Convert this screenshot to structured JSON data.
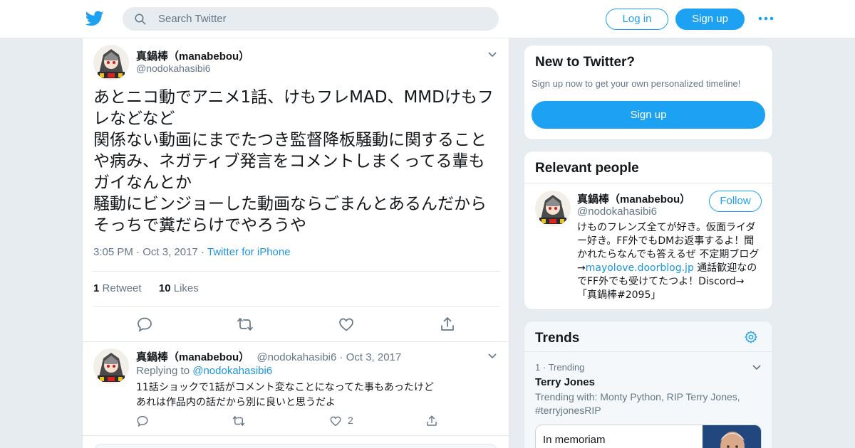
{
  "search": {
    "placeholder": "Search Twitter"
  },
  "header": {
    "login_label": "Log in",
    "signup_label": "Sign up"
  },
  "tweet": {
    "author_name": "真鍋棒（manabebou）",
    "author_handle": "@nodokahasibi6",
    "text": "あとニコ動でアニメ1話、けもフレMAD、MMDけもフレなどなど\n関係ない動画にまでたつき監督降板騒動に関することや病み、ネガティブ発言をコメントしまくってる輩もガイなんとか\n騒動にビンジョーした動画ならごまんとあるんだからそっちで糞だらけでやろうや",
    "time": "3:05 PM",
    "date": "Oct 3, 2017",
    "source": "Twitter for iPhone",
    "retweet_count": "1",
    "retweet_label": "Retweet",
    "like_count": "10",
    "like_label": "Likes"
  },
  "reply": {
    "author_name": "真鍋棒（manabebou）",
    "author_handle": "@nodokahasibi6",
    "date": "Oct 3, 2017",
    "replying_to_label": "Replying to",
    "replying_to_handle": "@nodokahasibi6",
    "text": "11話ショックで1話がコメント変なことになってた事もあったけど\nあれは作品内の話だから別に良いと思うだよ",
    "like_count": "2"
  },
  "new_to_twitter": {
    "title": "New to Twitter?",
    "subtitle": "Sign up now to get your own personalized timeline!",
    "button": "Sign up"
  },
  "relevant_people": {
    "title": "Relevant people",
    "name": "真鍋棒（manabebou）",
    "handle": "@nodokahasibi6",
    "follow_label": "Follow",
    "bio_part1": "けものフレンズ全てが好き。仮面ライダー好き。FF外でもDMお返事するよ！聞かれたらなんでも答えるぜ 不定期ブログ→",
    "bio_link": "mayolove.doorblog.jp",
    "bio_part2": " 通話歓迎なのでFF外でも受けてたつよ！Discord→ 「真鍋棒#2095」"
  },
  "trends": {
    "title": "Trends",
    "items": [
      {
        "rank": "1",
        "context": "Trending",
        "name": "Terry Jones",
        "with": "Trending with: Monty Python, RIP Terry Jones, #terryjonesRIP",
        "card_title": "In memoriam"
      }
    ]
  },
  "colors": {
    "accent": "#1da1f2",
    "link": "#1b95e0",
    "background": "#e6ecf0"
  }
}
